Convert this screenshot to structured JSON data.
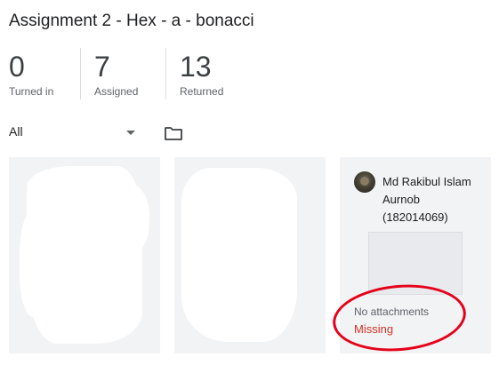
{
  "assignment": {
    "title": "Assignment 2 - Hex - a - bonacci"
  },
  "stats": [
    {
      "value": "0",
      "label": "Turned in"
    },
    {
      "value": "7",
      "label": "Assigned"
    },
    {
      "value": "13",
      "label": "Returned"
    }
  ],
  "filter": {
    "selected": "All"
  },
  "icons": {
    "folder": "folder-icon",
    "caret": "dropdown-caret-icon"
  },
  "student": {
    "name": "Md Rakibul Islam Aurnob",
    "id": "(182014069)",
    "attachment_status": "No attachments",
    "submission_status": "Missing"
  },
  "colors": {
    "missing": "#d93025",
    "annotation_ring": "#e6001a",
    "card_bg": "#f1f3f4"
  }
}
